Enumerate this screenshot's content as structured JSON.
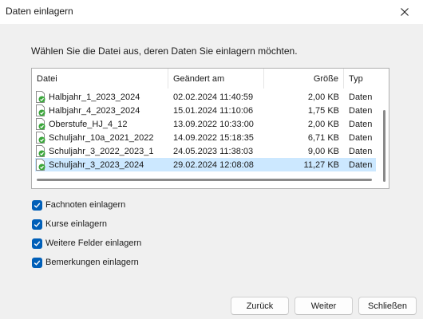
{
  "window": {
    "title": "Daten einlagern"
  },
  "instruction": "Wählen Sie die Datei aus, deren Daten Sie einlagern möchten.",
  "file_list": {
    "columns": [
      "Datei",
      "Geändert am",
      "Größe",
      "Typ"
    ],
    "rows": [
      {
        "name": "Halbjahr_1_2023_2024",
        "modified": "02.02.2024 11:40:59",
        "size": "2,00 KB",
        "type": "Daten",
        "selected": false
      },
      {
        "name": "Halbjahr_4_2023_2024",
        "modified": "15.01.2024 11:10:06",
        "size": "1,75 KB",
        "type": "Daten",
        "selected": false
      },
      {
        "name": "Oberstufe_HJ_4_12",
        "modified": "13.09.2022 10:33:00",
        "size": "2,00 KB",
        "type": "Daten",
        "selected": false
      },
      {
        "name": "Schuljahr_10a_2021_2022",
        "modified": "14.09.2022 15:18:35",
        "size": "6,71 KB",
        "type": "Daten",
        "selected": false
      },
      {
        "name": "Schuljahr_3_2022_2023_1",
        "modified": "24.05.2023 11:38:03",
        "size": "9,00 KB",
        "type": "Daten",
        "selected": false
      },
      {
        "name": "Schuljahr_3_2023_2024",
        "modified": "29.02.2024 12:08:08",
        "size": "11,27 KB",
        "type": "Daten",
        "selected": true
      }
    ]
  },
  "options": [
    {
      "label": "Fachnoten einlagern",
      "checked": true
    },
    {
      "label": "Kurse einlagern",
      "checked": true
    },
    {
      "label": "Weitere Felder einlagern",
      "checked": true
    },
    {
      "label": "Bemerkungen einlagern",
      "checked": true
    }
  ],
  "buttons": {
    "back": "Zurück",
    "next": "Weiter",
    "close": "Schließen"
  },
  "colors": {
    "accent": "#005fb8",
    "selection": "#cce8ff",
    "icon_green": "#3aa63a"
  },
  "icons": {
    "file": "data-file-check-icon",
    "close": "close-icon",
    "checkbox": "checkmark-icon"
  }
}
